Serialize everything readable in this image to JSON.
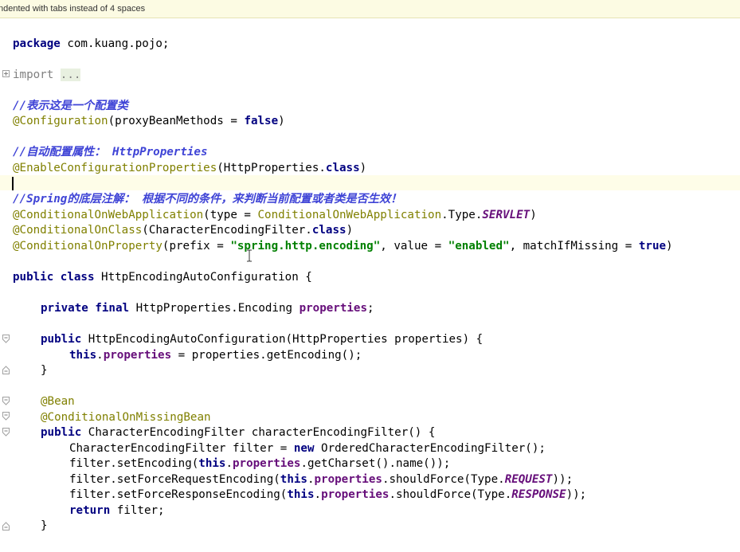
{
  "notification": "ndented with tabs instead of 4 spaces",
  "code": {
    "l1": {
      "kw": "package",
      "rest": " com.kuang.pojo;"
    },
    "l2": {
      "kw": "import",
      "folded": "..."
    },
    "l3": {
      "comment": "//表示这是一个配置类"
    },
    "l4": {
      "ann": "@Configuration",
      "a": "(proxyBeanMethods = ",
      "kw": "false",
      "b": ")"
    },
    "l5": {
      "comment": "//自动配置属性： HttpProperties"
    },
    "l6": {
      "ann": "@EnableConfigurationProperties",
      "a": "(HttpProperties.",
      "kw": "class",
      "b": ")"
    },
    "l7": {
      "comment": "//Spring的底层注解： 根据不同的条件，来判断当前配置或者类是否生效！"
    },
    "l8": {
      "ann": "@ConditionalOnWebApplication",
      "a": "(type = ",
      "ann2": "ConditionalOnWebApplication",
      "b": ".Type.",
      "const": "SERVLET",
      "c": ")"
    },
    "l9": {
      "ann": "@ConditionalOnClass",
      "a": "(CharacterEncodingFilter.",
      "kw": "class",
      "b": ")"
    },
    "l10": {
      "ann": "@ConditionalOnProperty",
      "a": "(prefix = ",
      "s1": "\"spring.http.encoding\"",
      "b": ", value = ",
      "s2": "\"enabled\"",
      "c": ", matchIfMissing = ",
      "kw": "true",
      "d": ")"
    },
    "l11": {
      "kw": "public class",
      "rest": " HttpEncodingAutoConfiguration {"
    },
    "l12": {
      "kw": "private final",
      "a": " HttpProperties.Encoding ",
      "fld": "properties",
      "b": ";"
    },
    "l13": {
      "kw": "public",
      "rest": " HttpEncodingAutoConfiguration(HttpProperties properties) {"
    },
    "l14": {
      "kw": "this",
      "a": ".",
      "fld": "properties",
      "b": " = properties.getEncoding();"
    },
    "l15": {
      "rest": "}"
    },
    "l16": {
      "ann": "@Bean"
    },
    "l17": {
      "ann": "@ConditionalOnMissingBean"
    },
    "l18": {
      "kw": "public",
      "rest": " CharacterEncodingFilter characterEncodingFilter() {"
    },
    "l19": {
      "a": "CharacterEncodingFilter filter = ",
      "kw": "new",
      "b": " OrderedCharacterEncodingFilter();"
    },
    "l20": {
      "a": "filter.setEncoding(",
      "kw": "this",
      "b": ".",
      "fld": "properties",
      "c": ".getCharset().name());"
    },
    "l21": {
      "a": "filter.setForceRequestEncoding(",
      "kw": "this",
      "b": ".",
      "fld": "properties",
      "c": ".shouldForce(Type.",
      "const": "REQUEST",
      "d": "));"
    },
    "l22": {
      "a": "filter.setForceResponseEncoding(",
      "kw": "this",
      "b": ".",
      "fld": "properties",
      "c": ".shouldForce(Type.",
      "const": "RESPONSE",
      "d": "));"
    },
    "l23": {
      "kw": "return",
      "rest": " filter;"
    },
    "l24": {
      "rest": "}"
    }
  }
}
